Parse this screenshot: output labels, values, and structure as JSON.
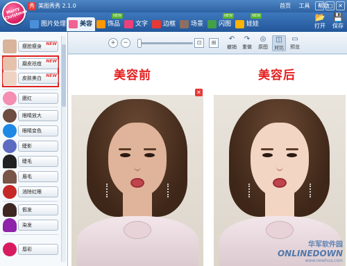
{
  "app": {
    "logo_text": "Merry Christmas",
    "icon_glyph": "秀",
    "title": "美图秀秀 2.1.0",
    "title_menus": [
      "首页",
      "工具",
      "帮助"
    ],
    "window_buttons": [
      "–",
      "□",
      "✕"
    ]
  },
  "tabs": [
    {
      "label": "图片处理",
      "icon_color": "#4a90d9",
      "active": false
    },
    {
      "label": "美容",
      "icon_color": "#f06292",
      "active": true
    },
    {
      "label": "饰品",
      "icon_color": "#ff9800",
      "active": false,
      "badge": "NEW"
    },
    {
      "label": "文字",
      "icon_color": "#ec407a",
      "active": false
    },
    {
      "label": "边框",
      "icon_color": "#e53935",
      "active": false
    },
    {
      "label": "场景",
      "icon_color": "#8d6e63",
      "active": false
    },
    {
      "label": "闪图",
      "icon_color": "#43a047",
      "active": false,
      "badge": "NEW"
    },
    {
      "label": "娃娃",
      "icon_color": "#ffb300",
      "active": false,
      "badge": "NEW"
    }
  ],
  "top_actions": [
    {
      "label": "打开",
      "icon": "folder-icon",
      "glyph": "📂"
    },
    {
      "label": "保存",
      "icon": "save-icon",
      "glyph": "💾"
    }
  ],
  "sidebar": {
    "items": [
      {
        "label": "瘦脸瘦身",
        "icon": "slim-face-icon",
        "new": true,
        "new_label": "NEW",
        "color": "#d9b39a"
      },
      {
        "label": "磨皮祛痘",
        "icon": "smooth-skin-icon",
        "new": true,
        "new_label": "NEW",
        "color": "#e6c2ad"
      },
      {
        "label": "皮肤美白",
        "icon": "whiten-skin-icon",
        "new": true,
        "new_label": "NEW",
        "color": "#f0d2c2"
      },
      {
        "label": "腮红",
        "icon": "blush-icon",
        "new": false,
        "color": "#f48fb1"
      },
      {
        "label": "眼睛放大",
        "icon": "eye-enlarge-icon",
        "new": false,
        "color": "#6d4c41"
      },
      {
        "label": "眼睛变色",
        "icon": "eye-color-icon",
        "new": false,
        "color": "#1e88e5"
      },
      {
        "label": "睫影",
        "icon": "eye-shadow-icon",
        "new": false,
        "color": "#5c6bc0"
      },
      {
        "label": "睫毛",
        "icon": "eyelash-icon",
        "new": false,
        "color": "#212121"
      },
      {
        "label": "眉毛",
        "icon": "eyebrow-icon",
        "new": false,
        "color": "#795548"
      },
      {
        "label": "消除红眼",
        "icon": "red-eye-icon",
        "new": false,
        "color": "#c62828"
      },
      {
        "label": "假发",
        "icon": "wig-icon",
        "new": false,
        "color": "#3e2723"
      },
      {
        "label": "染发",
        "icon": "hair-dye-icon",
        "new": false,
        "color": "#8e24aa"
      },
      {
        "label": "唇彩",
        "icon": "lip-gloss-icon",
        "new": false,
        "color": "#d81b60"
      }
    ]
  },
  "toolbar": {
    "zoom_in": "+",
    "zoom_out": "−",
    "fit_glyph": "⊡",
    "actual_glyph": "⊞",
    "actions": [
      {
        "label": "撤销",
        "glyph": "↶",
        "icon": "undo-icon"
      },
      {
        "label": "重做",
        "glyph": "↷",
        "icon": "redo-icon"
      },
      {
        "label": "原图",
        "glyph": "◎",
        "icon": "original-icon"
      },
      {
        "label": "对比",
        "glyph": "◫",
        "icon": "compare-icon",
        "pressed": true
      },
      {
        "label": "预览",
        "glyph": "▭",
        "icon": "preview-icon"
      }
    ]
  },
  "canvas": {
    "before_label": "美容前",
    "after_label": "美容后",
    "close_glyph": "✕"
  },
  "watermark": {
    "cn": "华军软件园",
    "en": "ONLINEDOWN",
    "url": "www.newhua.com"
  }
}
